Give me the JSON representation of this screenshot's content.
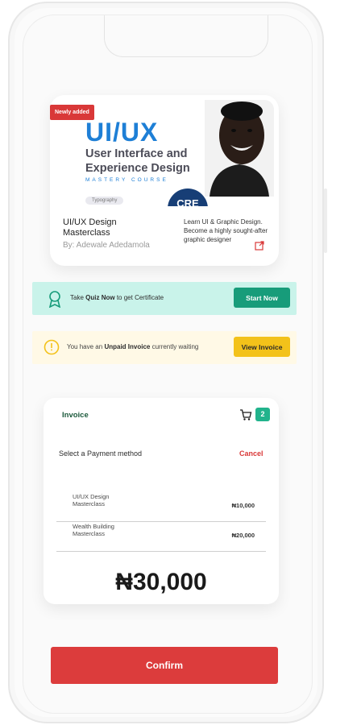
{
  "course": {
    "badge": "Newly added",
    "banner_title": "UI/UX",
    "banner_subtitle": "User Interface and Experience Design",
    "banner_caption": "MASTERY COURSE",
    "banner_tag": "Typography",
    "seal_text": "CRE",
    "name": "UI/UX Design Masterclass",
    "author": "By: Adewale Adedamola",
    "description": "Learn UI & Graphic Design. Become a highly sought-after graphic designer"
  },
  "quiz": {
    "prefix": "Take",
    "bold": "Quiz Now",
    "suffix": "to get Certificate",
    "button": "Start Now"
  },
  "notice": {
    "prefix": "You have an",
    "bold": "Unpaid Invoice",
    "suffix": "currently waiting",
    "button": "View Invoice"
  },
  "invoice": {
    "title": "Invoice",
    "cart_count": "2",
    "payment_label": "Select a Payment method",
    "cancel": "Cancel",
    "items": [
      {
        "name": "UI/UX Design Masterclass",
        "price": "₦10,000"
      },
      {
        "name": "Wealth Building Masterclass",
        "price": "₦20,000"
      }
    ],
    "total": "₦30,000"
  },
  "confirm_label": "Confirm",
  "colors": {
    "accent_green": "#179c7a",
    "accent_red": "#dc3c3c",
    "accent_yellow": "#f3c21a",
    "brand_blue": "#1e7fd6"
  }
}
